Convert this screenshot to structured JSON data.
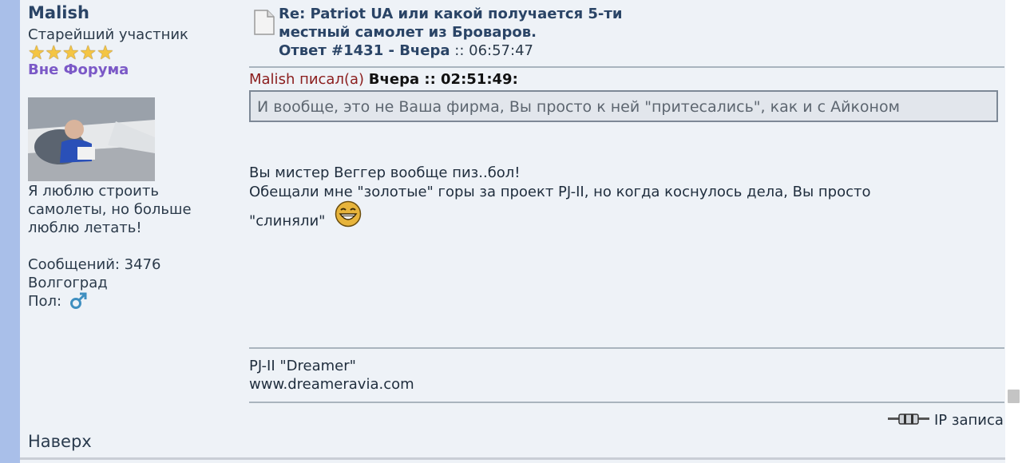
{
  "poster": {
    "name": "Malish",
    "rank": "Старейший участник",
    "stars_count": 5,
    "status": "Вне Форума",
    "signature_text": "Я люблю строить самолеты, но больше люблю летать!",
    "posts": "Сообщений: 3476",
    "city": "Волгоград",
    "gender_label": "Пол:",
    "gender_icon": "male-icon"
  },
  "post": {
    "title": "Re: Patriot UA или какой получается 5-ти местный самолет из Броваров.",
    "reply_label": "Ответ #1431 - Вчера",
    "reply_time": ":: 06:57:47",
    "quote_author": "Malish писал(а)",
    "quote_time": "Вчера :: 02:51:49:",
    "quote_text": "И вообще, это не Ваша фирма, Вы просто к ней \"притесались\", как и с Айконом",
    "body_line1": "Вы мистер Веггер вообще пиз..бол!",
    "body_line2": "Обещали мне \"золотые\" горы за проект PJ-II, но когда коснулось дела, Вы просто",
    "body_line3": "\"слиняли\"",
    "smiley_icon": "laughing-smiley-icon",
    "signature_line1": "PJ-II \"Dreamer\"",
    "signature_line2": "www.dreameravia.com",
    "ip_label": "IP записа"
  },
  "footer": {
    "top_link": "Наверх"
  },
  "colors": {
    "left_strip": "#a9bfe9",
    "panel": "#eef2f7",
    "status": "#7b59c7",
    "quote_author": "#8b1d1d"
  }
}
